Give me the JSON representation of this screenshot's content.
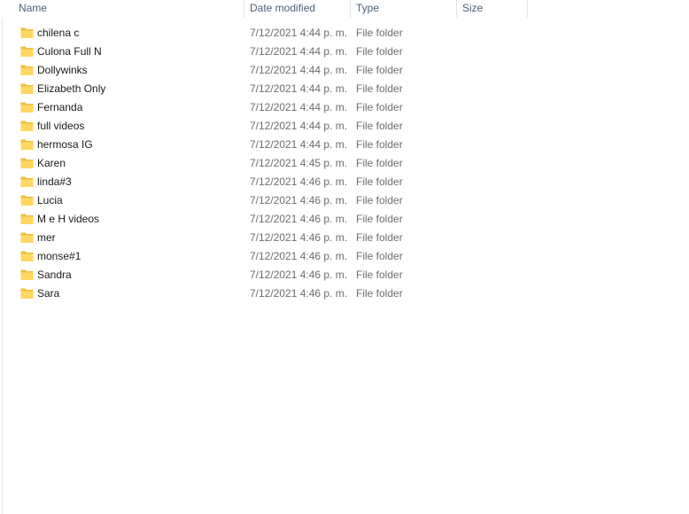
{
  "columns": {
    "name": "Name",
    "date_modified": "Date modified",
    "type": "Type",
    "size": "Size"
  },
  "icon": {
    "name": "folder-icon",
    "color_front": "#ffd862",
    "color_back": "#f0be3c"
  },
  "files": [
    {
      "name": "chilena c",
      "date": "7/12/2021 4:44 p. m.",
      "type": "File folder",
      "size": ""
    },
    {
      "name": "Culona Full N",
      "date": "7/12/2021 4:44 p. m.",
      "type": "File folder",
      "size": ""
    },
    {
      "name": "Dollywinks",
      "date": "7/12/2021 4:44 p. m.",
      "type": "File folder",
      "size": ""
    },
    {
      "name": "Elizabeth Only",
      "date": "7/12/2021 4:44 p. m.",
      "type": "File folder",
      "size": ""
    },
    {
      "name": "Fernanda",
      "date": "7/12/2021 4:44 p. m.",
      "type": "File folder",
      "size": ""
    },
    {
      "name": "full videos",
      "date": "7/12/2021 4:44 p. m.",
      "type": "File folder",
      "size": ""
    },
    {
      "name": "hermosa IG",
      "date": "7/12/2021 4:44 p. m.",
      "type": "File folder",
      "size": ""
    },
    {
      "name": "Karen",
      "date": "7/12/2021 4:45 p. m.",
      "type": "File folder",
      "size": ""
    },
    {
      "name": "linda#3",
      "date": "7/12/2021 4:46 p. m.",
      "type": "File folder",
      "size": ""
    },
    {
      "name": "Lucia",
      "date": "7/12/2021 4:46 p. m.",
      "type": "File folder",
      "size": ""
    },
    {
      "name": "M e H videos",
      "date": "7/12/2021 4:46 p. m.",
      "type": "File folder",
      "size": ""
    },
    {
      "name": "mer",
      "date": "7/12/2021 4:46 p. m.",
      "type": "File folder",
      "size": ""
    },
    {
      "name": "monse#1",
      "date": "7/12/2021 4:46 p. m.",
      "type": "File folder",
      "size": ""
    },
    {
      "name": "Sandra",
      "date": "7/12/2021 4:46 p. m.",
      "type": "File folder",
      "size": ""
    },
    {
      "name": "Sara",
      "date": "7/12/2021 4:46 p. m.",
      "type": "File folder",
      "size": ""
    }
  ]
}
